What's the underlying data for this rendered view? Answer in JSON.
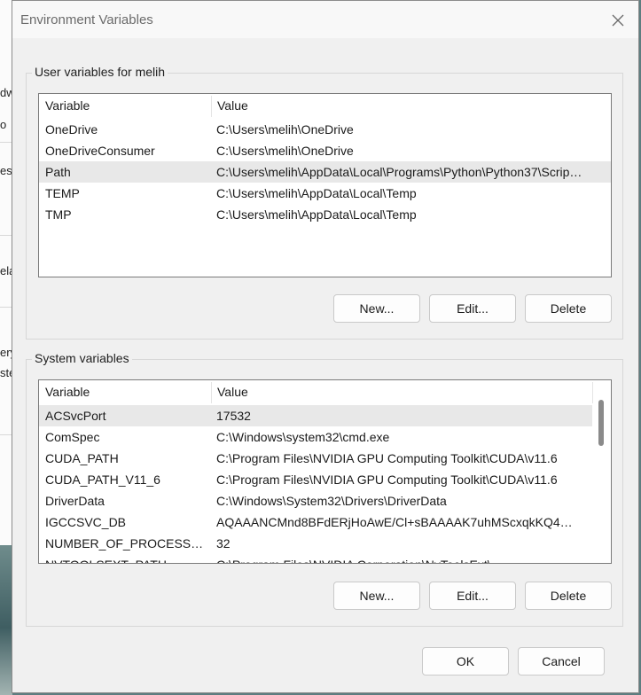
{
  "background_window": {
    "fragments": [
      "dw",
      "o",
      "es",
      "ela",
      "ery",
      "ste"
    ]
  },
  "dialog": {
    "title": "Environment Variables",
    "close_icon": "close-icon"
  },
  "user_vars": {
    "label": "User variables for melih",
    "columns": [
      "Variable",
      "Value"
    ],
    "rows": [
      {
        "name": "OneDrive",
        "value": "C:\\Users\\melih\\OneDrive"
      },
      {
        "name": "OneDriveConsumer",
        "value": "C:\\Users\\melih\\OneDrive"
      },
      {
        "name": "Path",
        "value": "C:\\Users\\melih\\AppData\\Local\\Programs\\Python\\Python37\\Scrip…",
        "selected": true
      },
      {
        "name": "TEMP",
        "value": "C:\\Users\\melih\\AppData\\Local\\Temp"
      },
      {
        "name": "TMP",
        "value": "C:\\Users\\melih\\AppData\\Local\\Temp"
      }
    ],
    "buttons": {
      "new": "New...",
      "edit": "Edit...",
      "delete": "Delete"
    }
  },
  "system_vars": {
    "label": "System variables",
    "columns": [
      "Variable",
      "Value"
    ],
    "rows": [
      {
        "name": "ACSvcPort",
        "value": "17532",
        "selected": true
      },
      {
        "name": "ComSpec",
        "value": "C:\\Windows\\system32\\cmd.exe"
      },
      {
        "name": "CUDA_PATH",
        "value": "C:\\Program Files\\NVIDIA GPU Computing Toolkit\\CUDA\\v11.6"
      },
      {
        "name": "CUDA_PATH_V11_6",
        "value": "C:\\Program Files\\NVIDIA GPU Computing Toolkit\\CUDA\\v11.6"
      },
      {
        "name": "DriverData",
        "value": "C:\\Windows\\System32\\Drivers\\DriverData"
      },
      {
        "name": "IGCCSVC_DB",
        "value": "AQAAANCMnd8BFdERjHoAwE/Cl+sBAAAAK7uhMScxqkKQ4…"
      },
      {
        "name": "NUMBER_OF_PROCESSORS",
        "value": "32"
      },
      {
        "name": "NVTOOLSEXT_PATH",
        "value": "C:\\Program Files\\NVIDIA Corporation\\NvToolsExt\\"
      }
    ],
    "buttons": {
      "new": "New...",
      "edit": "Edit...",
      "delete": "Delete"
    }
  },
  "footer": {
    "ok": "OK",
    "cancel": "Cancel"
  }
}
